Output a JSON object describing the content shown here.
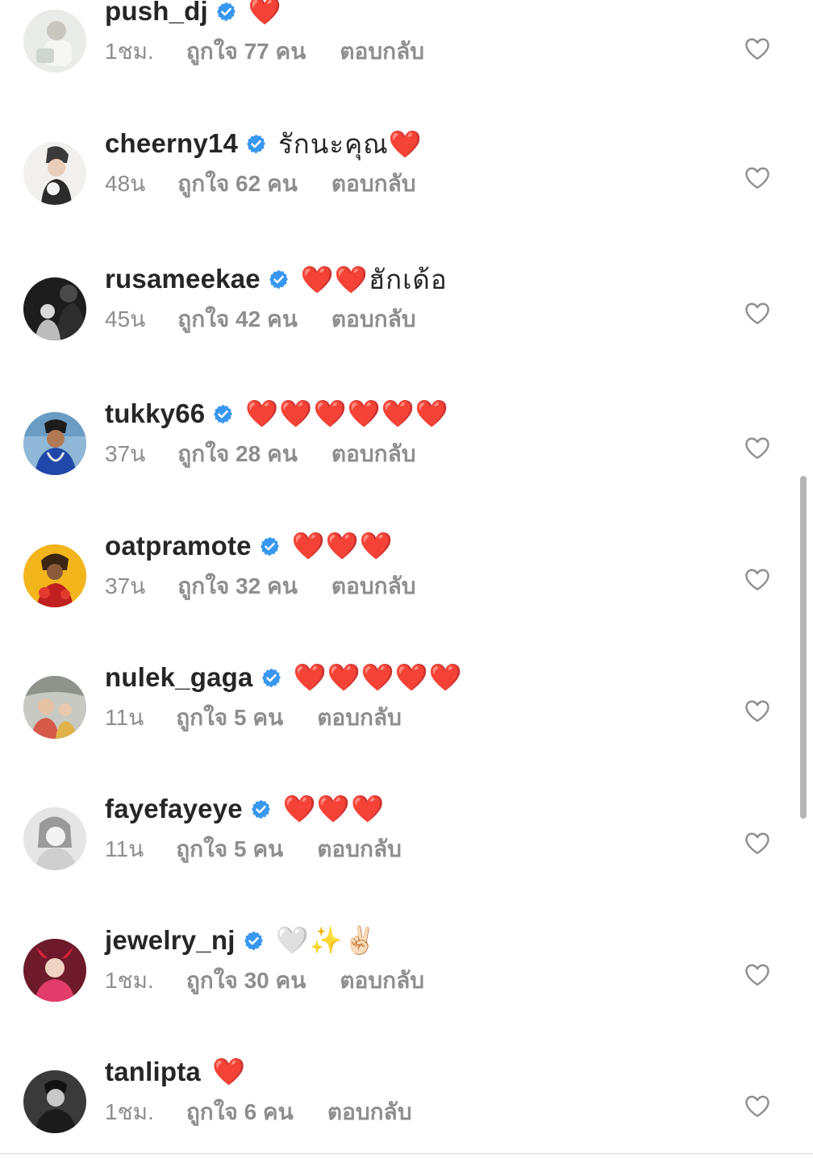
{
  "comments": [
    {
      "username": "push_dj",
      "verified": true,
      "text": "❤️",
      "time": "1ชม.",
      "likes": "ถูกใจ 77 คน",
      "reply": "ตอบกลับ",
      "avatar": "avatar-push-dj"
    },
    {
      "username": "cheerny14",
      "verified": true,
      "text": "รักนะคุณ❤️",
      "time": "48น",
      "likes": "ถูกใจ 62 คน",
      "reply": "ตอบกลับ",
      "avatar": "avatar-cheerny14"
    },
    {
      "username": "rusameekae",
      "verified": true,
      "text": "❤️❤️ฮักเด้อ",
      "time": "45น",
      "likes": "ถูกใจ 42 คน",
      "reply": "ตอบกลับ",
      "avatar": "avatar-rusameekae"
    },
    {
      "username": "tukky66",
      "verified": true,
      "text": "❤️❤️❤️❤️❤️❤️",
      "time": "37น",
      "likes": "ถูกใจ 28 คน",
      "reply": "ตอบกลับ",
      "avatar": "avatar-tukky66"
    },
    {
      "username": "oatpramote",
      "verified": true,
      "text": "❤️❤️❤️",
      "time": "37น",
      "likes": "ถูกใจ 32 คน",
      "reply": "ตอบกลับ",
      "avatar": "avatar-oatpramote"
    },
    {
      "username": "nulek_gaga",
      "verified": true,
      "text": "❤️❤️❤️❤️❤️",
      "time": "11น",
      "likes": "ถูกใจ 5 คน",
      "reply": "ตอบกลับ",
      "avatar": "avatar-nulek-gaga"
    },
    {
      "username": "fayefayeye",
      "verified": true,
      "text": "❤️❤️❤️",
      "time": "11น",
      "likes": "ถูกใจ 5 คน",
      "reply": "ตอบกลับ",
      "avatar": "avatar-fayefayeye"
    },
    {
      "username": "jewelry_nj",
      "verified": true,
      "text": "🤍✨✌🏻",
      "time": "1ชม.",
      "likes": "ถูกใจ 30 คน",
      "reply": "ตอบกลับ",
      "avatar": "avatar-jewelry-nj"
    },
    {
      "username": "tanlipta",
      "verified": false,
      "text": "❤️",
      "time": "1ชม.",
      "likes": "ถูกใจ 6 คน",
      "reply": "ตอบกลับ",
      "avatar": "avatar-tanlipta"
    }
  ],
  "icons": {
    "verified": "verified-badge-icon",
    "like": "heart-outline-icon"
  },
  "colors": {
    "verified_blue": "#3897f0",
    "heart_red": "#e8232f",
    "secondary_text": "#8e8e8e",
    "primary_text": "#262626"
  }
}
